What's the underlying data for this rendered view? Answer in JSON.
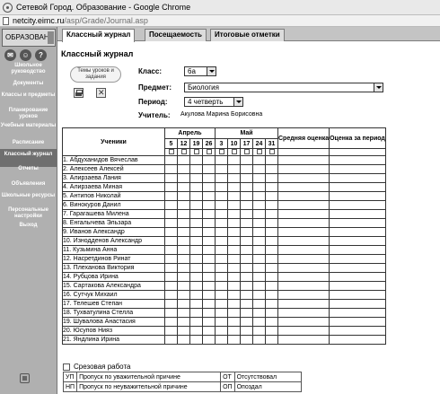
{
  "window": {
    "title": "Сетевой Город. Образование - Google Chrome"
  },
  "address": {
    "host": "netcity.eimc.ru",
    "path": "/asp/Grade/Journal.asp"
  },
  "sidebar": {
    "logo": "ОБРАЗОВАН",
    "items": [
      {
        "label": "Школьное руководство"
      },
      {
        "label": "Документы"
      },
      {
        "label": "Классы и предметы"
      },
      {
        "label": "Планирование уроков"
      },
      {
        "label": "Учебные материалы"
      },
      {
        "label": "Расписание"
      },
      {
        "label": "Классный журнал"
      },
      {
        "label": "Отчеты"
      },
      {
        "label": "Объявления"
      },
      {
        "label": "Школьные ресурсы"
      },
      {
        "label": "Персональные настройки"
      },
      {
        "label": "Выход"
      }
    ]
  },
  "tabs": [
    {
      "label": "Классный журнал"
    },
    {
      "label": "Посещаемость"
    },
    {
      "label": "Итоговые отметки"
    }
  ],
  "page_title": "Классный журнал",
  "topics_button": "Темы уроков и задания",
  "form": {
    "class_label": "Класс:",
    "class_value": "6а",
    "subject_label": "Предмет:",
    "subject_value": "Биология",
    "period_label": "Период:",
    "period_value": "4 четверть",
    "teacher_label": "Учитель:",
    "teacher_value": "Акулова Марина Борисовна"
  },
  "journal": {
    "students_header": "Ученики",
    "months": [
      {
        "name": "Апрель",
        "days": [
          "5",
          "12",
          "19",
          "26"
        ]
      },
      {
        "name": "Май",
        "days": [
          "3",
          "10",
          "17",
          "24",
          "31"
        ]
      }
    ],
    "average_header": "Средняя оценка",
    "period_grade_header": "Оценка за период",
    "students": [
      "1. Абдуханидов Вячеслав",
      "2. Алексеев Алексей",
      "3. Алирзаева Лания",
      "4. Алирзаева Миная",
      "5. Антипов Николай",
      "6. Винокуров Данил",
      "7. Гарагашева Милена",
      "8. Енгалычева Эльзара",
      "9. Иванов Александр",
      "10. Изнодденов Александр",
      "11. Кузьмина Анна",
      "12. Насретдинов Ринат",
      "13. Плеханова Виктория",
      "14. Рубцова Ирина",
      "15. Сартакова Александра",
      "16. Сутчук Михаил",
      "17. Телешев Степан",
      "18. Тухватулина Стелла",
      "19. Шувалова Анастасия",
      "20. Юсупов Нияз",
      "21. Яндлина Ирина"
    ]
  },
  "legend": {
    "checkbox_label": "Срезовая работа",
    "rows": [
      [
        "УП",
        "Пропуск по уважительной причине",
        "ОТ",
        "Отсутствовал"
      ],
      [
        "НП",
        "Пропуск по неуважительной причине",
        "ОП",
        "Опоздал"
      ]
    ]
  }
}
